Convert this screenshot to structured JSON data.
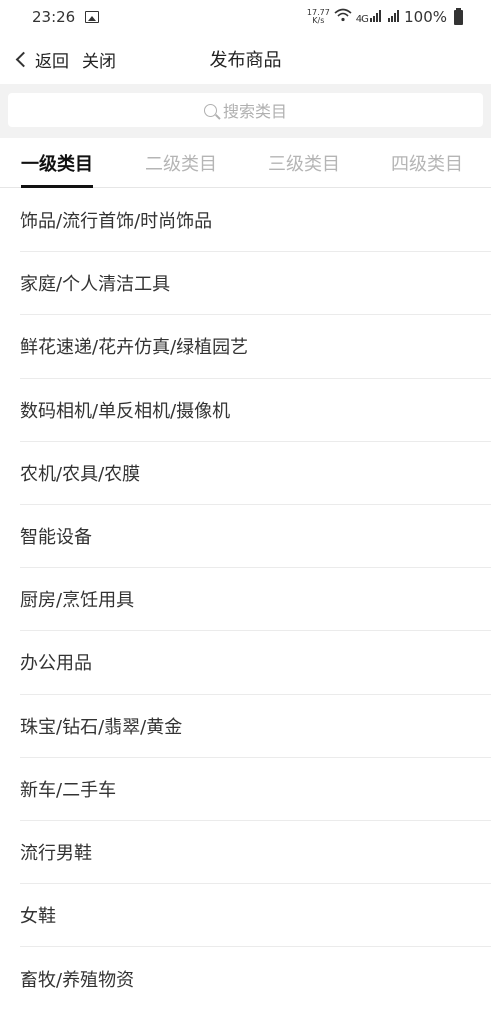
{
  "status": {
    "time": "23:26",
    "speed_top": "17.77",
    "speed_unit": "K/s",
    "net": "4G",
    "battery": "100%"
  },
  "nav": {
    "back_label": "返回",
    "close_label": "关闭",
    "title": "发布商品"
  },
  "search": {
    "placeholder": "搜索类目"
  },
  "tabs": [
    "一级类目",
    "二级类目",
    "三级类目",
    "四级类目"
  ],
  "categories": [
    "饰品/流行首饰/时尚饰品",
    "家庭/个人清洁工具",
    "鲜花速递/花卉仿真/绿植园艺",
    "数码相机/单反相机/摄像机",
    "农机/农具/农膜",
    "智能设备",
    "厨房/烹饪用具",
    "办公用品",
    "珠宝/钻石/翡翠/黄金",
    "新车/二手车",
    "流行男鞋",
    "女鞋",
    "畜牧/养殖物资"
  ]
}
